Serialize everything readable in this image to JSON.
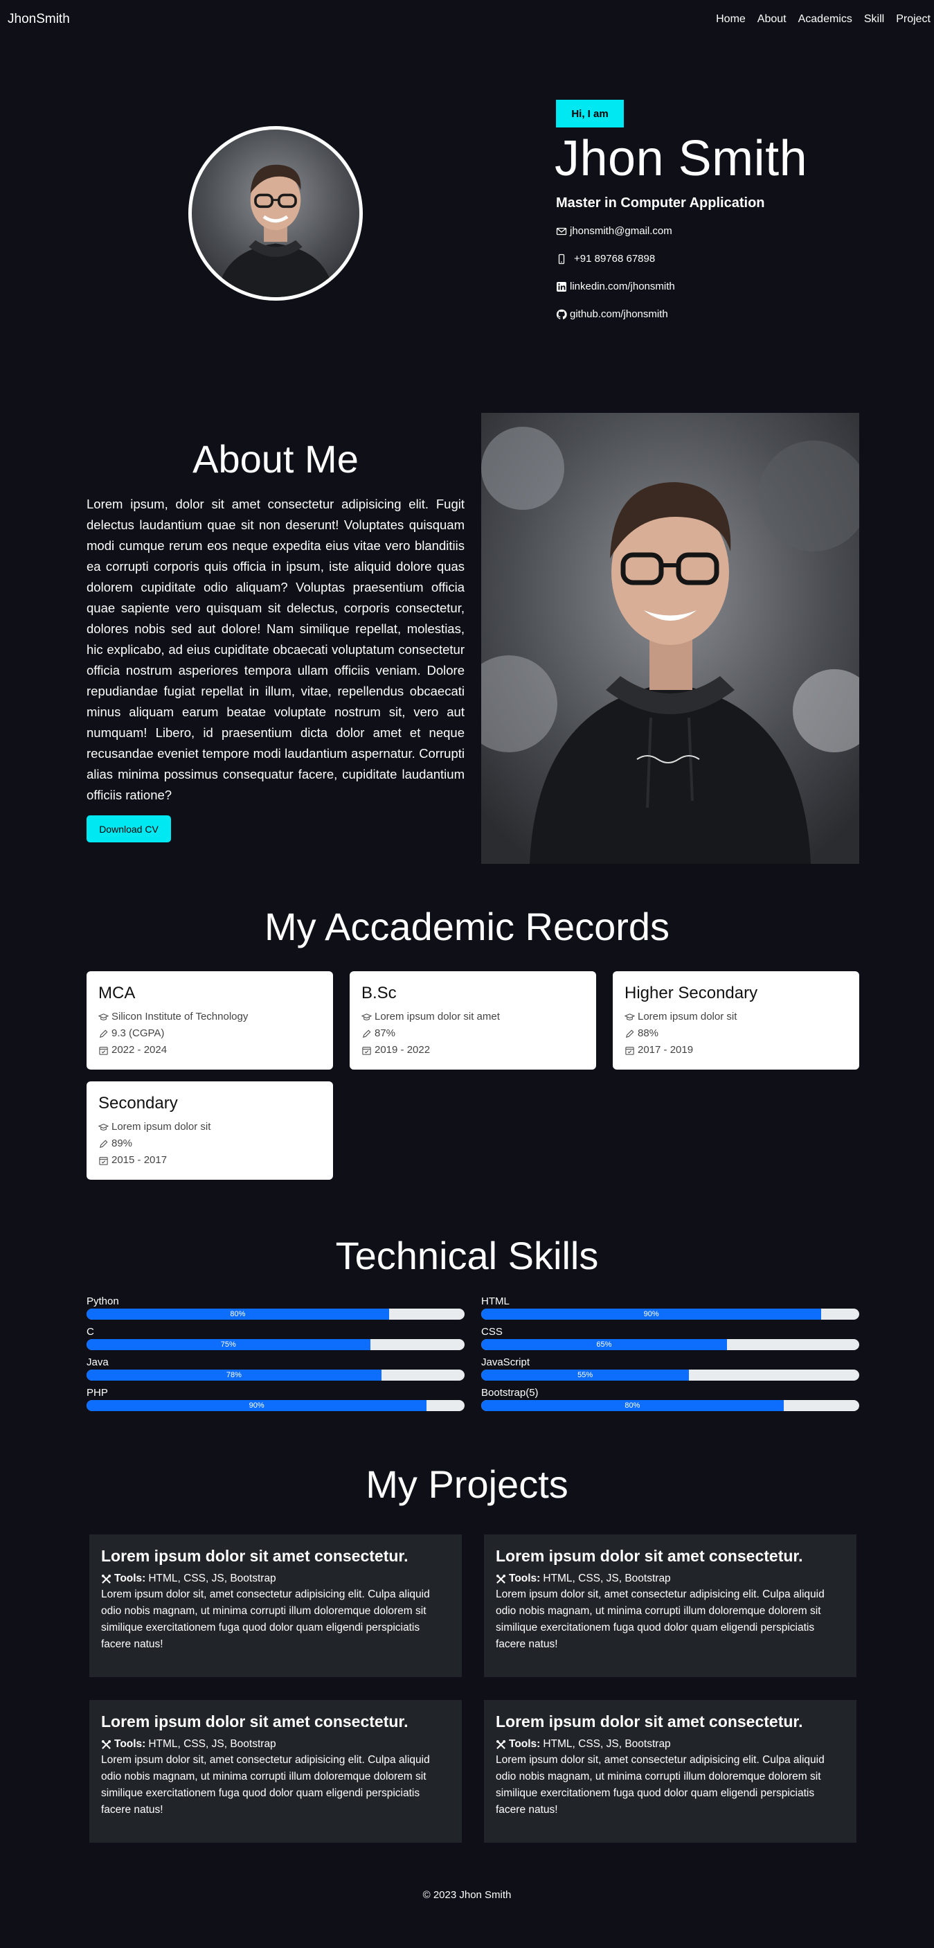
{
  "nav": {
    "brand": "JhonSmith",
    "links": [
      "Home",
      "About",
      "Academics",
      "Skill",
      "Project"
    ]
  },
  "hero": {
    "badge": "Hi, I am",
    "name": "Jhon Smith",
    "degree": "Master in Computer Application",
    "email": "jhonsmith@gmail.com",
    "phone": "+91 89768 67898",
    "linkedin": "linkedin.com/jhonsmith",
    "github": "github.com/jhonsmith"
  },
  "about": {
    "title": "About Me",
    "text": "Lorem ipsum, dolor sit amet consectetur adipisicing elit. Fugit delectus laudantium quae sit non deserunt! Voluptates quisquam modi cumque rerum eos neque expedita eius vitae vero blanditiis ea corrupti corporis quis officia in ipsum, iste aliquid dolore quas dolorem cupiditate odio aliquam? Voluptas praesentium officia quae sapiente vero quisquam sit delectus, corporis consectetur, dolores nobis sed aut dolore! Nam similique repellat, molestias, hic explicabo, ad eius cupiditate obcaecati voluptatum consectetur officia nostrum asperiores tempora ullam officiis veniam. Dolore repudiandae fugiat repellat in illum, vitae, repellendus obcaecati minus aliquam earum beatae voluptate nostrum sit, vero aut numquam! Libero, id praesentium dicta dolor amet et neque recusandae eveniet tempore modi laudantium aspernatur. Corrupti alias minima possimus consequatur facere, cupiditate laudantium officiis ratione?",
    "button": "Download CV"
  },
  "academics": {
    "title": "My Accademic Records",
    "records": [
      {
        "title": "MCA",
        "school": "Silicon Institute of Technology",
        "score": "9.3 (CGPA)",
        "years": "2022 - 2024"
      },
      {
        "title": "B.Sc",
        "school": "Lorem ipsum dolor sit amet",
        "score": "87%",
        "years": "2019 - 2022"
      },
      {
        "title": "Higher Secondary",
        "school": "Lorem ipsum dolor sit",
        "score": "88%",
        "years": "2017 - 2019"
      },
      {
        "title": "Secondary",
        "school": "Lorem ipsum dolor sit",
        "score": "89%",
        "years": "2015 - 2017"
      }
    ]
  },
  "skills": {
    "title": "Technical Skills",
    "left": [
      {
        "name": "Python",
        "value": 80,
        "label": "80%"
      },
      {
        "name": "C",
        "value": 75,
        "label": "75%"
      },
      {
        "name": "Java",
        "value": 78,
        "label": "78%"
      },
      {
        "name": "PHP",
        "value": 90,
        "label": "90%"
      }
    ],
    "right": [
      {
        "name": "HTML",
        "value": 90,
        "label": "90%"
      },
      {
        "name": "CSS",
        "value": 65,
        "label": "65%"
      },
      {
        "name": "JavaScript",
        "value": 55,
        "label": "55%"
      },
      {
        "name": "Bootstrap(5)",
        "value": 80,
        "label": "80%"
      }
    ]
  },
  "projects": {
    "title": "My Projects",
    "tools_label": "Tools:",
    "items": [
      {
        "title": "Lorem ipsum dolor sit amet consectetur.",
        "tools": "HTML, CSS, JS, Bootstrap",
        "desc": "Lorem ipsum dolor sit, amet consectetur adipisicing elit. Culpa aliquid odio nobis magnam, ut minima corrupti illum doloremque dolorem sit similique exercitationem fuga quod dolor quam eligendi perspiciatis facere natus!"
      },
      {
        "title": "Lorem ipsum dolor sit amet consectetur.",
        "tools": "HTML, CSS, JS, Bootstrap",
        "desc": "Lorem ipsum dolor sit, amet consectetur adipisicing elit. Culpa aliquid odio nobis magnam, ut minima corrupti illum doloremque dolorem sit similique exercitationem fuga quod dolor quam eligendi perspiciatis facere natus!"
      },
      {
        "title": "Lorem ipsum dolor sit amet consectetur.",
        "tools": "HTML, CSS, JS, Bootstrap",
        "desc": "Lorem ipsum dolor sit, amet consectetur adipisicing elit. Culpa aliquid odio nobis magnam, ut minima corrupti illum doloremque dolorem sit similique exercitationem fuga quod dolor quam eligendi perspiciatis facere natus!"
      },
      {
        "title": "Lorem ipsum dolor sit amet consectetur.",
        "tools": "HTML, CSS, JS, Bootstrap",
        "desc": "Lorem ipsum dolor sit, amet consectetur adipisicing elit. Culpa aliquid odio nobis magnam, ut minima corrupti illum doloremque dolorem sit similique exercitationem fuga quod dolor quam eligendi perspiciatis facere natus!"
      }
    ]
  },
  "footer": {
    "text": "© 2023 Jhon Smith"
  },
  "colors": {
    "accent": "#00e9f3",
    "progress": "#0d6efd",
    "background": "#0f0f17",
    "project_card": "#212529"
  },
  "icons": [
    "envelope-icon",
    "phone-icon",
    "linkedin-icon",
    "github-icon",
    "school-icon",
    "pencil-icon",
    "calendar-icon",
    "tools-icon"
  ]
}
